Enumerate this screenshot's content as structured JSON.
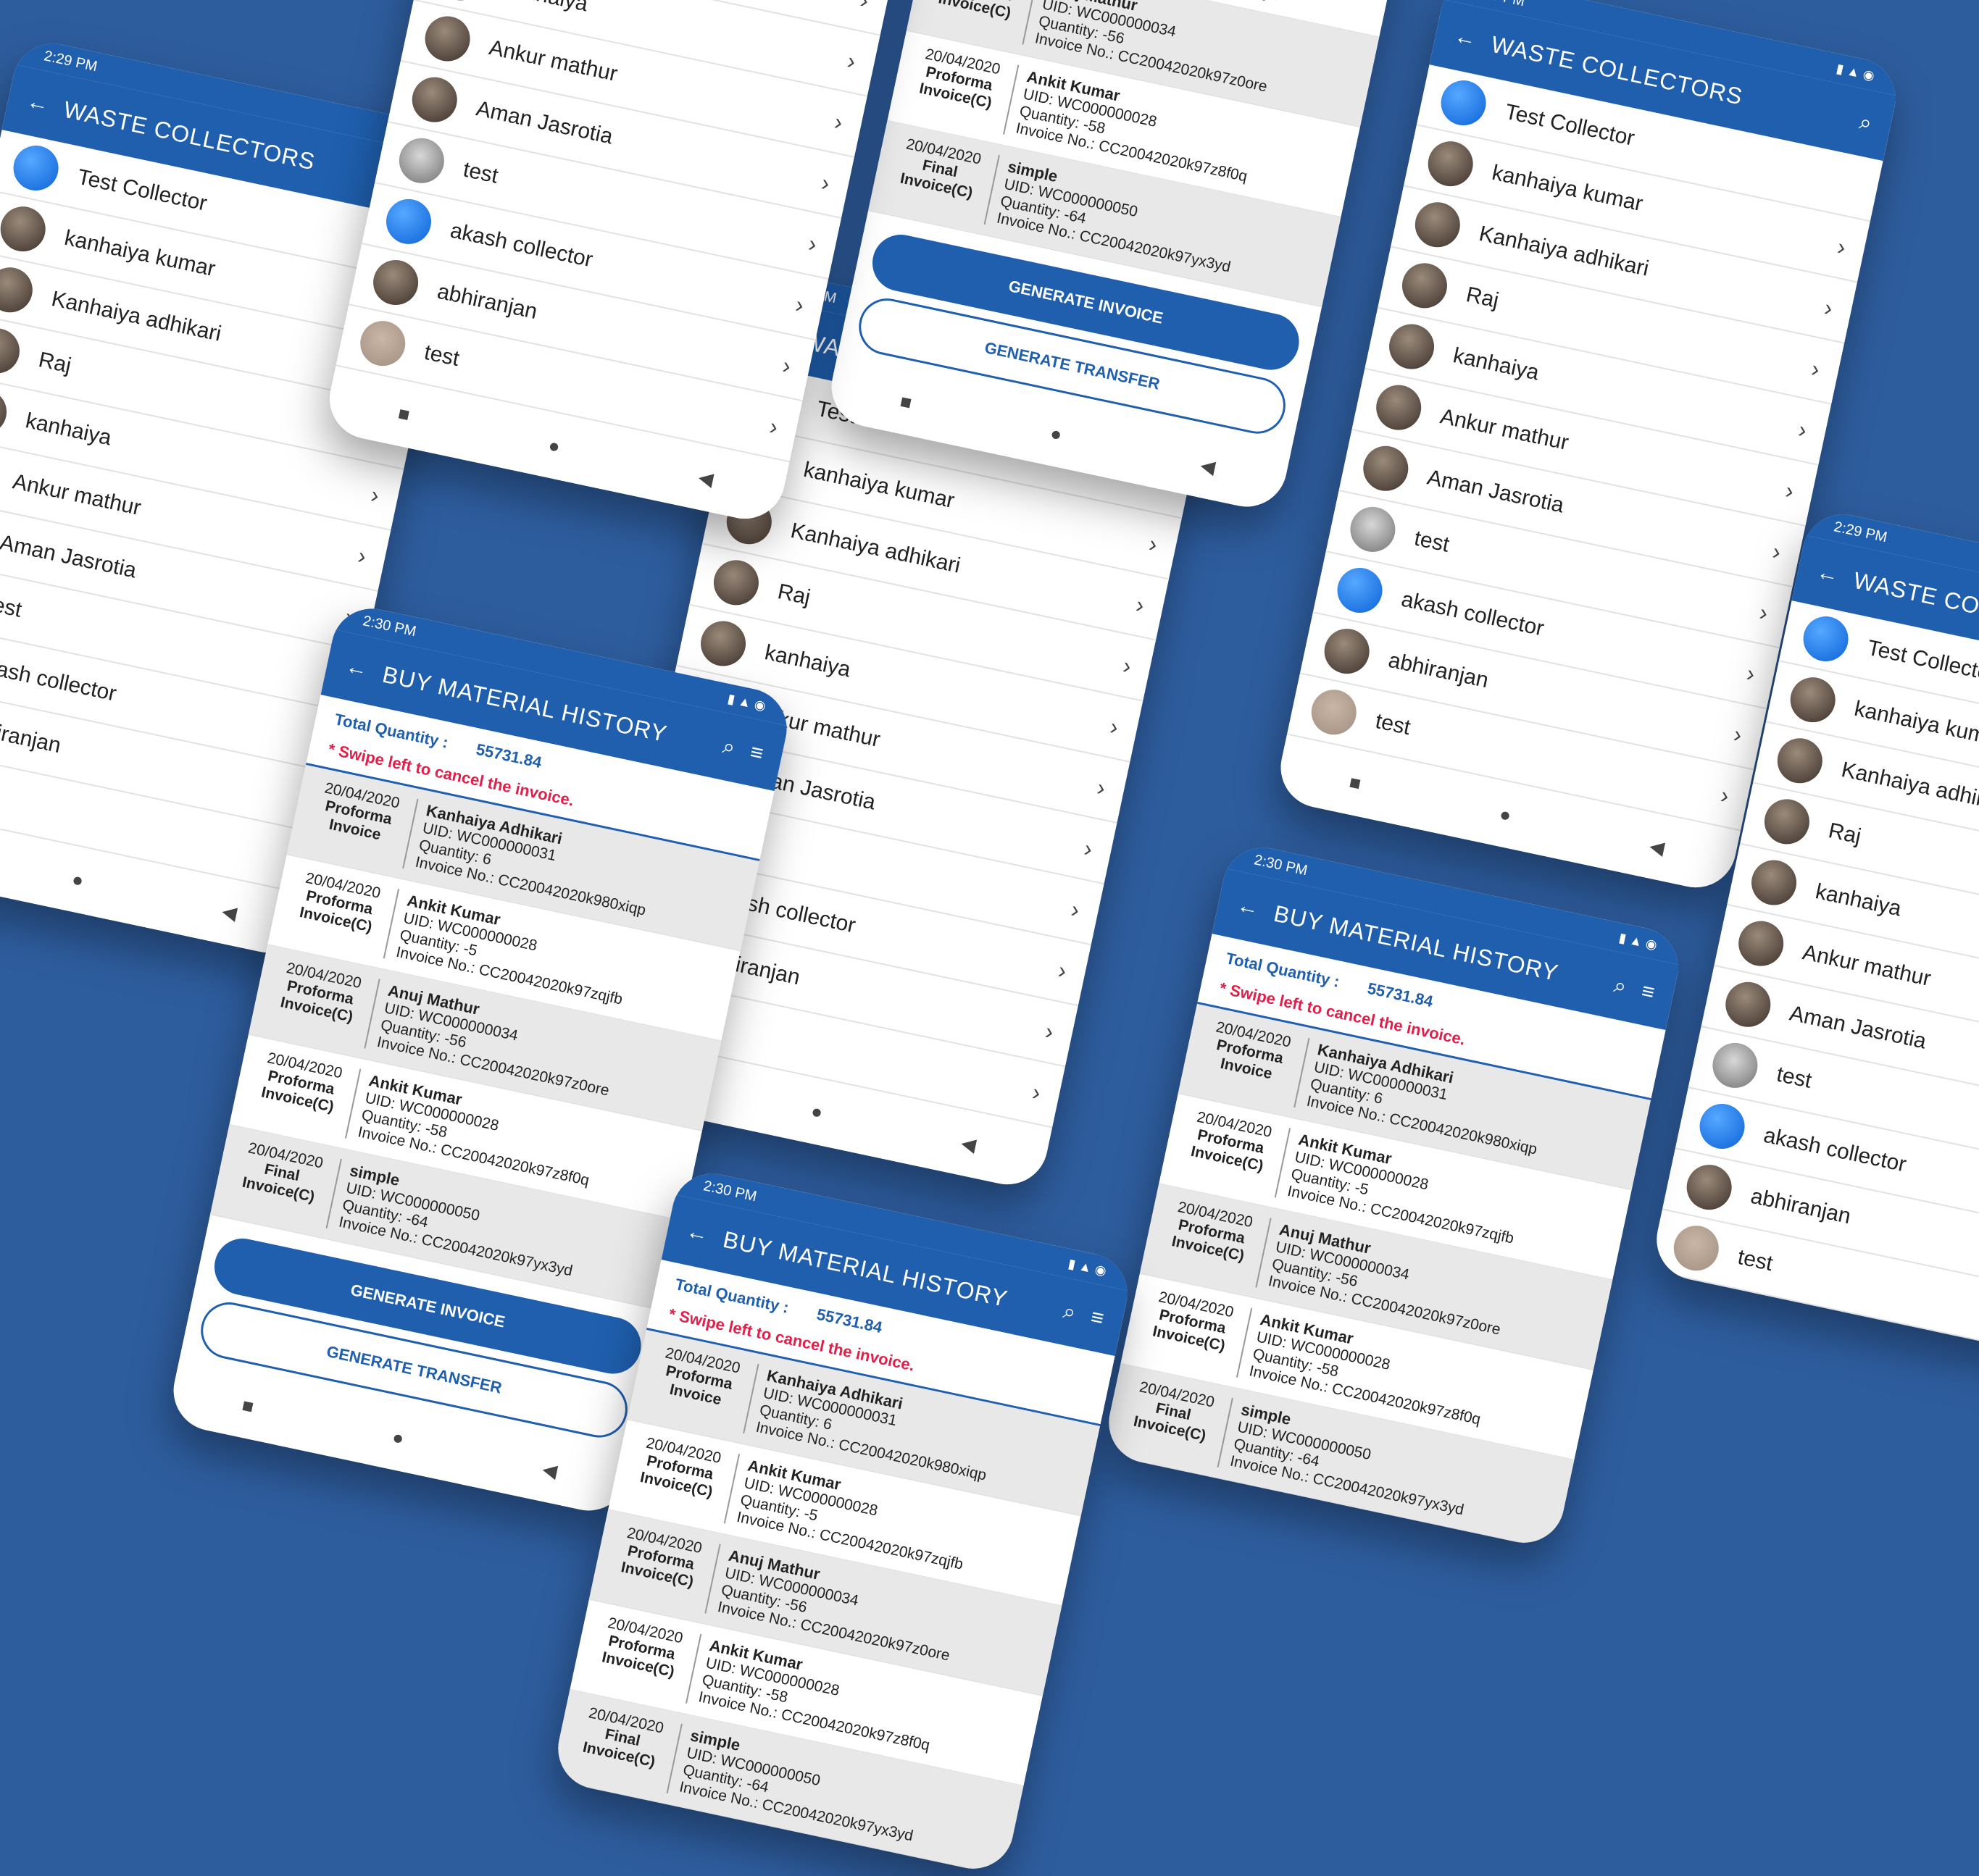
{
  "status": {
    "time_a": "2:29 PM",
    "time_b": "2:30 PM",
    "icons": "▮ ▲ ◉"
  },
  "collectors_screen": {
    "title": "WASTE COLLECTORS",
    "items": [
      {
        "name": "Test Collector",
        "avatar": "blue"
      },
      {
        "name": "kanhaiya kumar",
        "avatar": "photo"
      },
      {
        "name": "Kanhaiya adhikari",
        "avatar": "photo"
      },
      {
        "name": "Raj",
        "avatar": "photo"
      },
      {
        "name": "kanhaiya",
        "avatar": "photo"
      },
      {
        "name": "Ankur mathur",
        "avatar": "photo"
      },
      {
        "name": "Aman Jasrotia",
        "avatar": "photo"
      },
      {
        "name": "test",
        "avatar": "grey"
      },
      {
        "name": "akash collector",
        "avatar": "blue"
      },
      {
        "name": "abhiranjan",
        "avatar": "photo"
      },
      {
        "name": "test",
        "avatar": "beige"
      }
    ]
  },
  "history_screen": {
    "title": "BUY MATERIAL HISTORY",
    "total_label": "Total Quantity :",
    "total_value": "55731.84",
    "hint": "* Swipe left to cancel the invoice.",
    "invoices": [
      {
        "date": "20/04/2020",
        "type": "Proforma Invoice",
        "name": "Kanhaiya Adhikari",
        "uid": "UID: WC000000031",
        "qty": "Quantity: 6",
        "inv": "Invoice No.: CC20042020k980xiqp"
      },
      {
        "date": "20/04/2020",
        "type": "Proforma Invoice(C)",
        "name": "Ankit Kumar",
        "uid": "UID: WC000000028",
        "qty": "Quantity: -5",
        "inv": "Invoice No.: CC20042020k97zqjfb"
      },
      {
        "date": "20/04/2020",
        "type": "Proforma Invoice(C)",
        "name": "Anuj Mathur",
        "uid": "UID: WC000000034",
        "qty": "Quantity: -56",
        "inv": "Invoice No.: CC20042020k97z0ore"
      },
      {
        "date": "20/04/2020",
        "type": "Proforma Invoice(C)",
        "name": "Ankit Kumar",
        "uid": "UID: WC000000028",
        "qty": "Quantity: -58",
        "inv": "Invoice No.: CC20042020k97z8f0q"
      },
      {
        "date": "20/04/2020",
        "type": "Final Invoice(C)",
        "name": "simple",
        "uid": "UID: WC000000050",
        "qty": "Quantity: -64",
        "inv": "Invoice No.: CC20042020k97yx3yd"
      }
    ],
    "generate_invoice": "GENERATE INVOICE",
    "generate_transfer": "GENERATE TRANSFER"
  },
  "icons": {
    "back": "back-arrow-icon",
    "search": "search-icon",
    "filter": "filter-icon",
    "chevron": "chevron-right-icon"
  },
  "colors": {
    "primary": "#1f5fae",
    "background": "#2e5d9e",
    "warning": "#e0204a"
  }
}
